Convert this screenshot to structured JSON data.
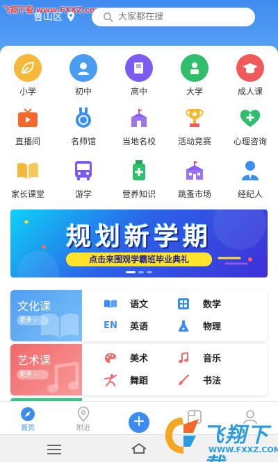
{
  "watermark_top": "飞翔下载 www.FXXZ.com",
  "header": {
    "location": "鲁山区",
    "search_placeholder": "大家都在搜"
  },
  "grid": [
    [
      {
        "label": "小学",
        "icon": "leaf-icon",
        "color": "#f6b83a"
      },
      {
        "label": "初中",
        "icon": "person-icon",
        "color": "#4a9cf0"
      },
      {
        "label": "高中",
        "icon": "book-icon",
        "color": "#7c5cf0"
      },
      {
        "label": "大学",
        "icon": "student-icon",
        "color": "#2fbf6b"
      },
      {
        "label": "成人课",
        "icon": "graduation-cap-icon",
        "color": "#f05a5a"
      }
    ],
    [
      {
        "label": "直播间",
        "icon": "tv-icon",
        "color": "#f4692b"
      },
      {
        "label": "名师馆",
        "icon": "medal-icon",
        "color": "#3a8ef0"
      },
      {
        "label": "当地名校",
        "icon": "school-icon",
        "color": "#8a5cf0"
      },
      {
        "label": "活动竞赛",
        "icon": "trophy-icon",
        "color": "#f6b52a"
      },
      {
        "label": "心理咨询",
        "icon": "heart-plus-icon",
        "color": "#2fbf6b"
      }
    ],
    [
      {
        "label": "家长课堂",
        "icon": "open-book-icon",
        "color": "#f6b83a"
      },
      {
        "label": "游学",
        "icon": "bus-icon",
        "color": "#7c5cf0"
      },
      {
        "label": "营养知识",
        "icon": "bottle-icon",
        "color": "#2fbf6b"
      },
      {
        "label": "跳蚤市场",
        "icon": "market-icon",
        "color": "#8a5cf0"
      },
      {
        "label": "经纪人",
        "icon": "agent-icon",
        "color": "#3a8ef0"
      }
    ]
  ],
  "banner": {
    "title": "规划新学期",
    "subtitle": "点击来围观学霸班毕业典礼"
  },
  "courses": [
    {
      "title": "文化课",
      "more": "更多 ›",
      "color": "#5aa8f2",
      "subjects": [
        {
          "label": "语文",
          "icon": "open-book-icon"
        },
        {
          "label": "数学",
          "icon": "calculator-icon"
        },
        {
          "label": "英语",
          "icon": "en-icon",
          "icon_text": "EN"
        },
        {
          "label": "物理",
          "icon": "flask-icon"
        }
      ]
    },
    {
      "title": "艺术课",
      "more": "更多 ›",
      "color": "#f47a7a",
      "subjects": [
        {
          "label": "美术",
          "icon": "palette-icon"
        },
        {
          "label": "音乐",
          "icon": "music-note-icon"
        },
        {
          "label": "舞蹈",
          "icon": "dancer-icon"
        },
        {
          "label": "书法",
          "icon": "brush-icon"
        }
      ]
    }
  ],
  "bottom_nav": [
    {
      "label": "首页",
      "icon": "compass-icon",
      "active": true
    },
    {
      "label": "附近",
      "icon": "location-pin-icon",
      "active": false
    },
    {
      "label": "",
      "icon": "plus-icon",
      "active": false
    },
    {
      "label": "",
      "icon": "folder-icon",
      "active": false
    },
    {
      "label": "",
      "icon": "profile-icon",
      "active": false
    }
  ],
  "brand": {
    "text": "飞翔下载",
    "url": "WWW.FXXZ.COM"
  }
}
